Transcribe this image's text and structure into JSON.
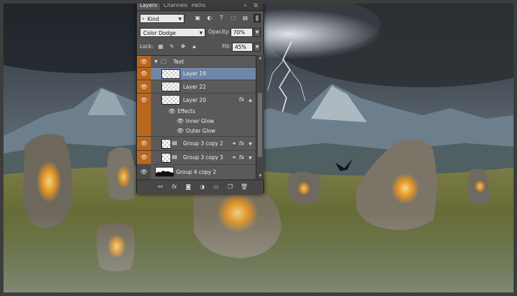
{
  "panel": {
    "tabs": [
      {
        "label": "Layers",
        "active": true
      },
      {
        "label": "Channels",
        "active": false
      },
      {
        "label": "Paths",
        "active": false
      }
    ],
    "tab_tools": {
      "collapse_icon": "double-chevron-icon",
      "menu_icon": "panel-menu-icon"
    },
    "filter": {
      "kind_label": "Kind",
      "icons": [
        "pixel-filter-icon",
        "adjustment-filter-icon",
        "type-filter-icon",
        "shape-filter-icon",
        "smart-object-filter-icon"
      ]
    },
    "blend": {
      "mode": "Color Dodge",
      "opacity_label": "Opacity:",
      "opacity_value": "70%",
      "fill_label": "Fill:",
      "fill_value": "45%"
    },
    "lock": {
      "label": "Lock:",
      "icons": [
        "lock-transparent-icon",
        "lock-image-icon",
        "lock-position-icon",
        "lock-all-icon"
      ]
    },
    "layers": [
      {
        "name": "Text",
        "type": "group"
      },
      {
        "name": "Layer 19",
        "type": "layer",
        "selected": true
      },
      {
        "name": "Layer 22",
        "type": "layer"
      },
      {
        "name": "Layer 20",
        "type": "layer",
        "fx": "fx"
      },
      {
        "name": "Effects",
        "type": "effects"
      },
      {
        "name": "Inner Glow",
        "type": "effect"
      },
      {
        "name": "Outer Glow",
        "type": "effect"
      },
      {
        "name": "Group 3 copy 2",
        "type": "smart",
        "fx": "fx"
      },
      {
        "name": "Group 3 copy 3",
        "type": "smart",
        "fx": "fx"
      },
      {
        "name": "Group 4 copy 2",
        "type": "mask"
      }
    ],
    "footer_icons": [
      "link-layers-icon",
      "fx-icon",
      "add-mask-icon",
      "adjustment-layer-icon",
      "new-group-icon",
      "new-layer-icon",
      "trash-icon"
    ],
    "footer_fx": "fx"
  },
  "colors": {
    "accent_orange": "#b8671d",
    "selected_row": "#6f86a6",
    "panel_bg": "#535353"
  }
}
